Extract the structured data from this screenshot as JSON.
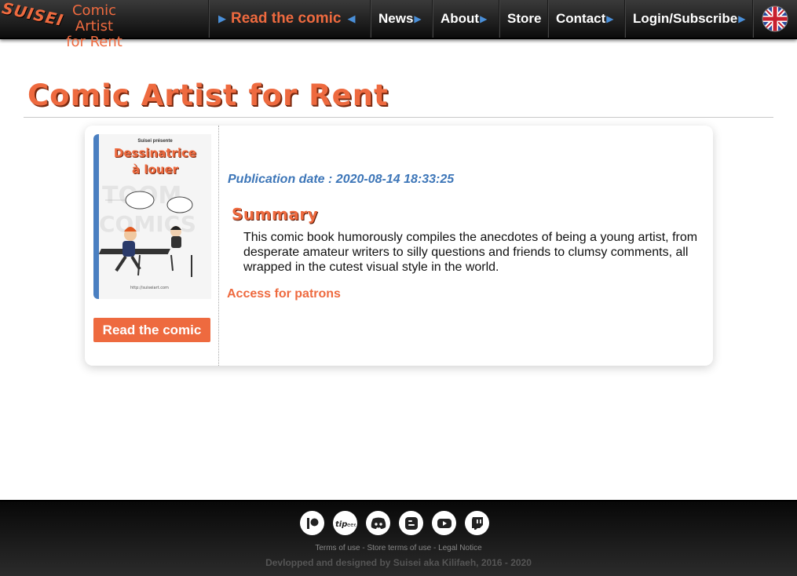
{
  "header": {
    "logo_mark": "SUISEI",
    "logo_line1": "Comic Artist",
    "logo_line2": "for Rent",
    "nav": [
      {
        "label": "Read the comic"
      },
      {
        "label": "News"
      },
      {
        "label": "About"
      },
      {
        "label": "Store"
      },
      {
        "label": "Contact"
      },
      {
        "label": "Login/Subscribe"
      }
    ],
    "language_icon": "uk-flag-icon"
  },
  "page": {
    "title": "Comic Artist for Rent"
  },
  "comic": {
    "cover_presenter": "Suisei présente",
    "cover_title_1": "Dessinatrice",
    "cover_title_2": "à louer",
    "read_button": "Read the comic",
    "publication_date": "Publication date : 2020-08-14 18:33:25",
    "summary_heading": "Summary",
    "summary_text": "This comic book humorously compiles the anecdotes of being a young artist, from desperate amateur writers to silly questions and friends to clumsy comments, all wrapped in the cutest visual style in the world.",
    "patron_link": "Access for patrons"
  },
  "footer": {
    "social_icons": [
      "patreon-icon",
      "tipeee-icon",
      "discord-icon",
      "blogger-icon",
      "youtube-icon",
      "twitch-icon"
    ],
    "terms": "Terms of use",
    "sep1": " - ",
    "store_terms": "Store terms of use",
    "sep2": " - ",
    "legal": "Legal Notice",
    "credit": "Devlopped and designed by Suisei aka Kilifaeh, 2016 - 2020"
  },
  "colors": {
    "accent": "#ee6a3f",
    "blue": "#3d76b8",
    "bar": "#1a1a1a"
  }
}
